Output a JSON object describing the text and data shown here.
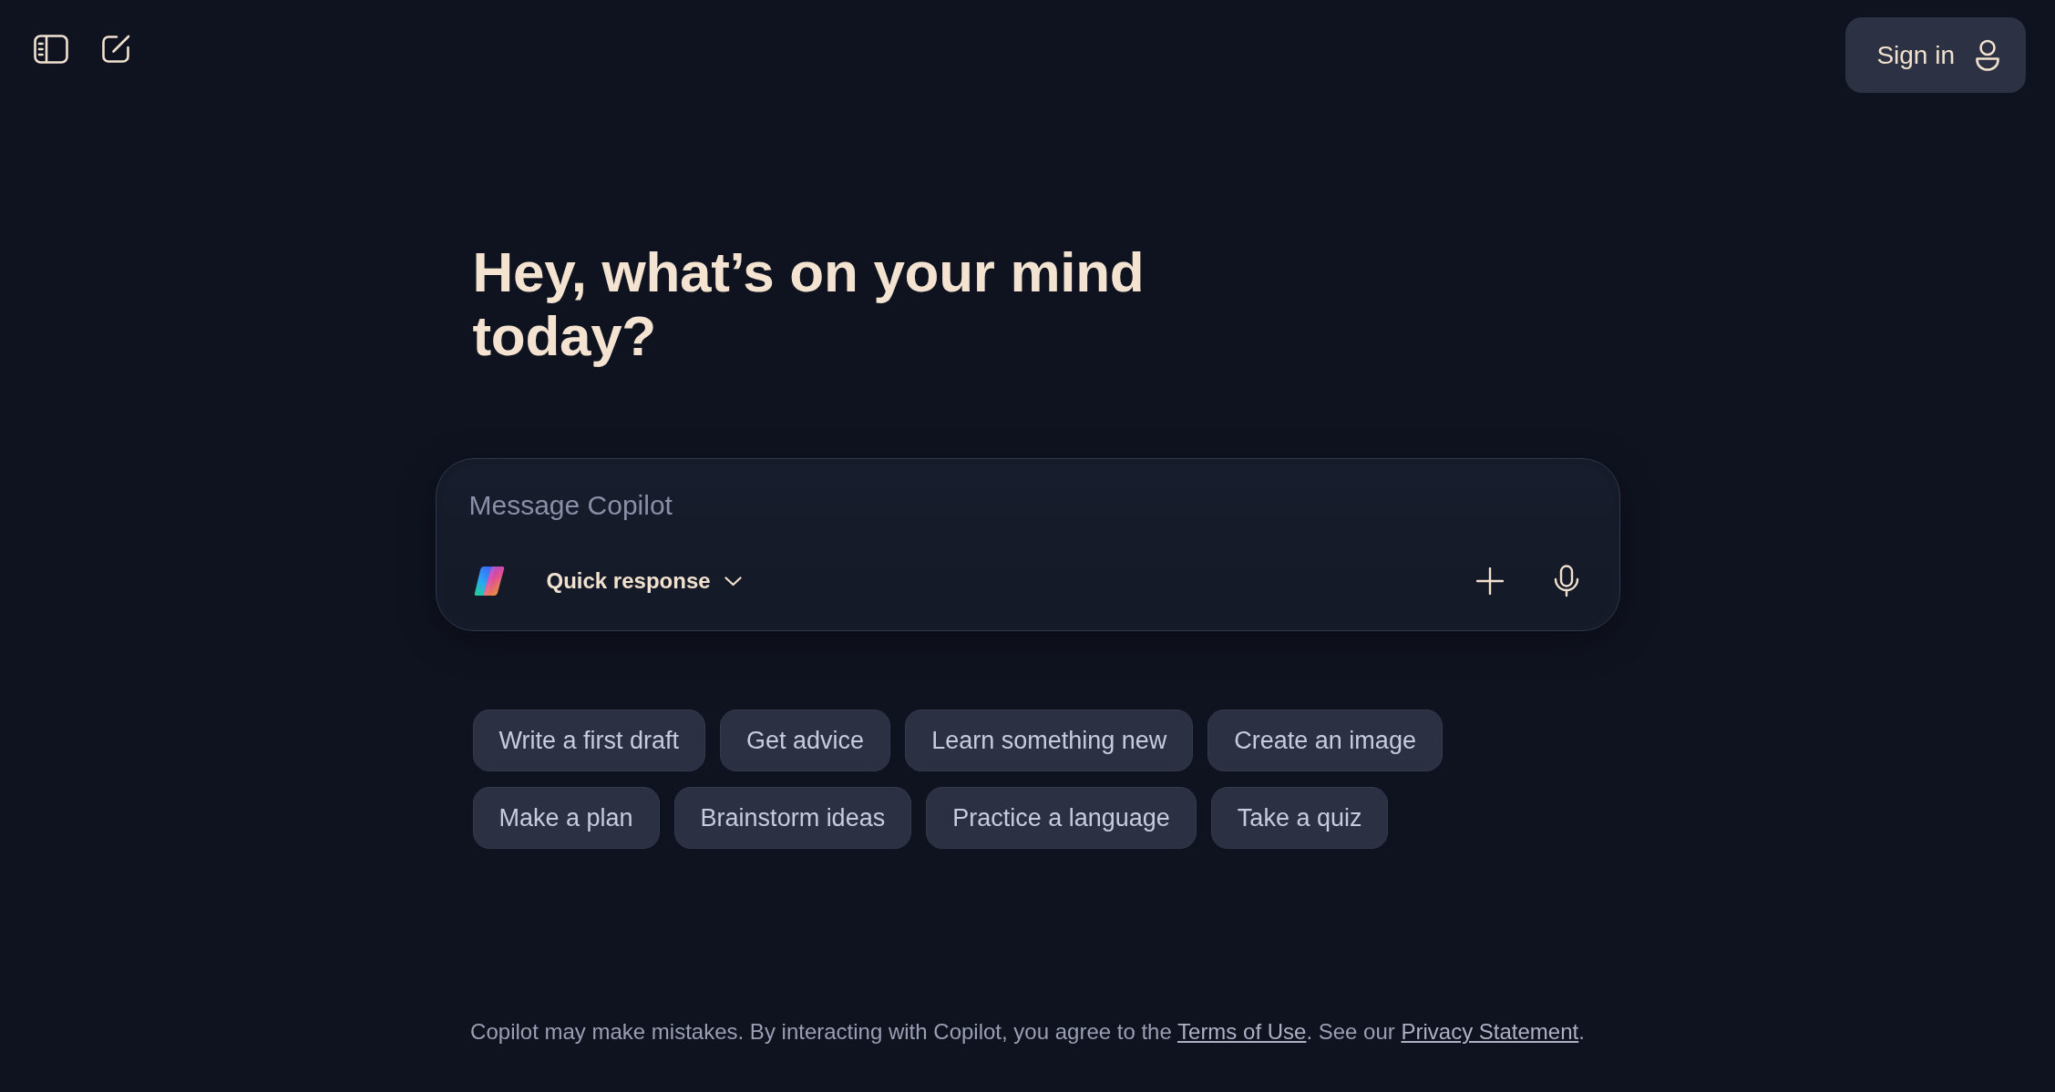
{
  "sign_in": {
    "label": "Sign in"
  },
  "heading": "Hey, what’s on your mind today?",
  "composer": {
    "placeholder": "Message Copilot",
    "mode": "Quick response"
  },
  "suggestion_rows": [
    [
      "Write a first draft",
      "Get advice",
      "Learn something new",
      "Create an image"
    ],
    [
      "Make a plan",
      "Brainstorm ideas",
      "Practice a language",
      "Take a quiz"
    ]
  ],
  "footer": {
    "parts": [
      {
        "kind": "text",
        "text": "Copilot may make mistakes. By interacting with Copilot, you agree to the "
      },
      {
        "kind": "link",
        "text": "Terms of Use"
      },
      {
        "kind": "text",
        "text": ". See our "
      },
      {
        "kind": "link",
        "text": "Privacy Statement"
      },
      {
        "kind": "text",
        "text": "."
      }
    ]
  }
}
